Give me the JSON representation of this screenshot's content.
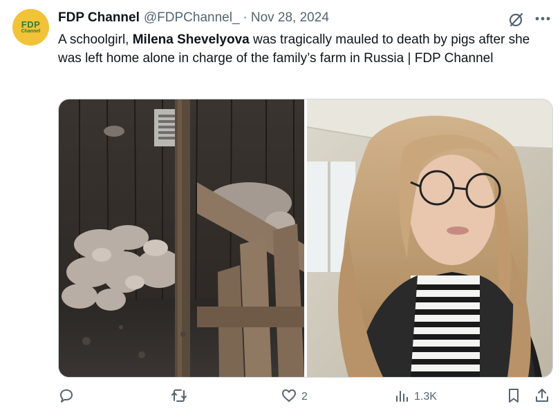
{
  "tweet": {
    "avatar": {
      "line1": "FDP",
      "line2": "Channel"
    },
    "author_name": "FDP Channel",
    "handle": "@FDPChannel_",
    "separator": "·",
    "date": "Nov 28, 2024",
    "text_before": "A schoolgirl, ",
    "text_bold": "Milena Shevelyova",
    "text_after": " was tragically mauled to death by pigs after she was left home alone in charge of the family’s farm in Russia | FDP Channel"
  },
  "media": [
    {
      "icon": "pig-pen-photo"
    },
    {
      "icon": "portrait-photo"
    }
  ],
  "actions": {
    "reply_count": "",
    "retweet_count": "",
    "like_count": "2",
    "views_count": "1.3K"
  },
  "colors": {
    "text": "#0f1419",
    "secondary": "#536471",
    "avatar_bg": "#f2c238",
    "avatar_text": "#2e7d32"
  }
}
